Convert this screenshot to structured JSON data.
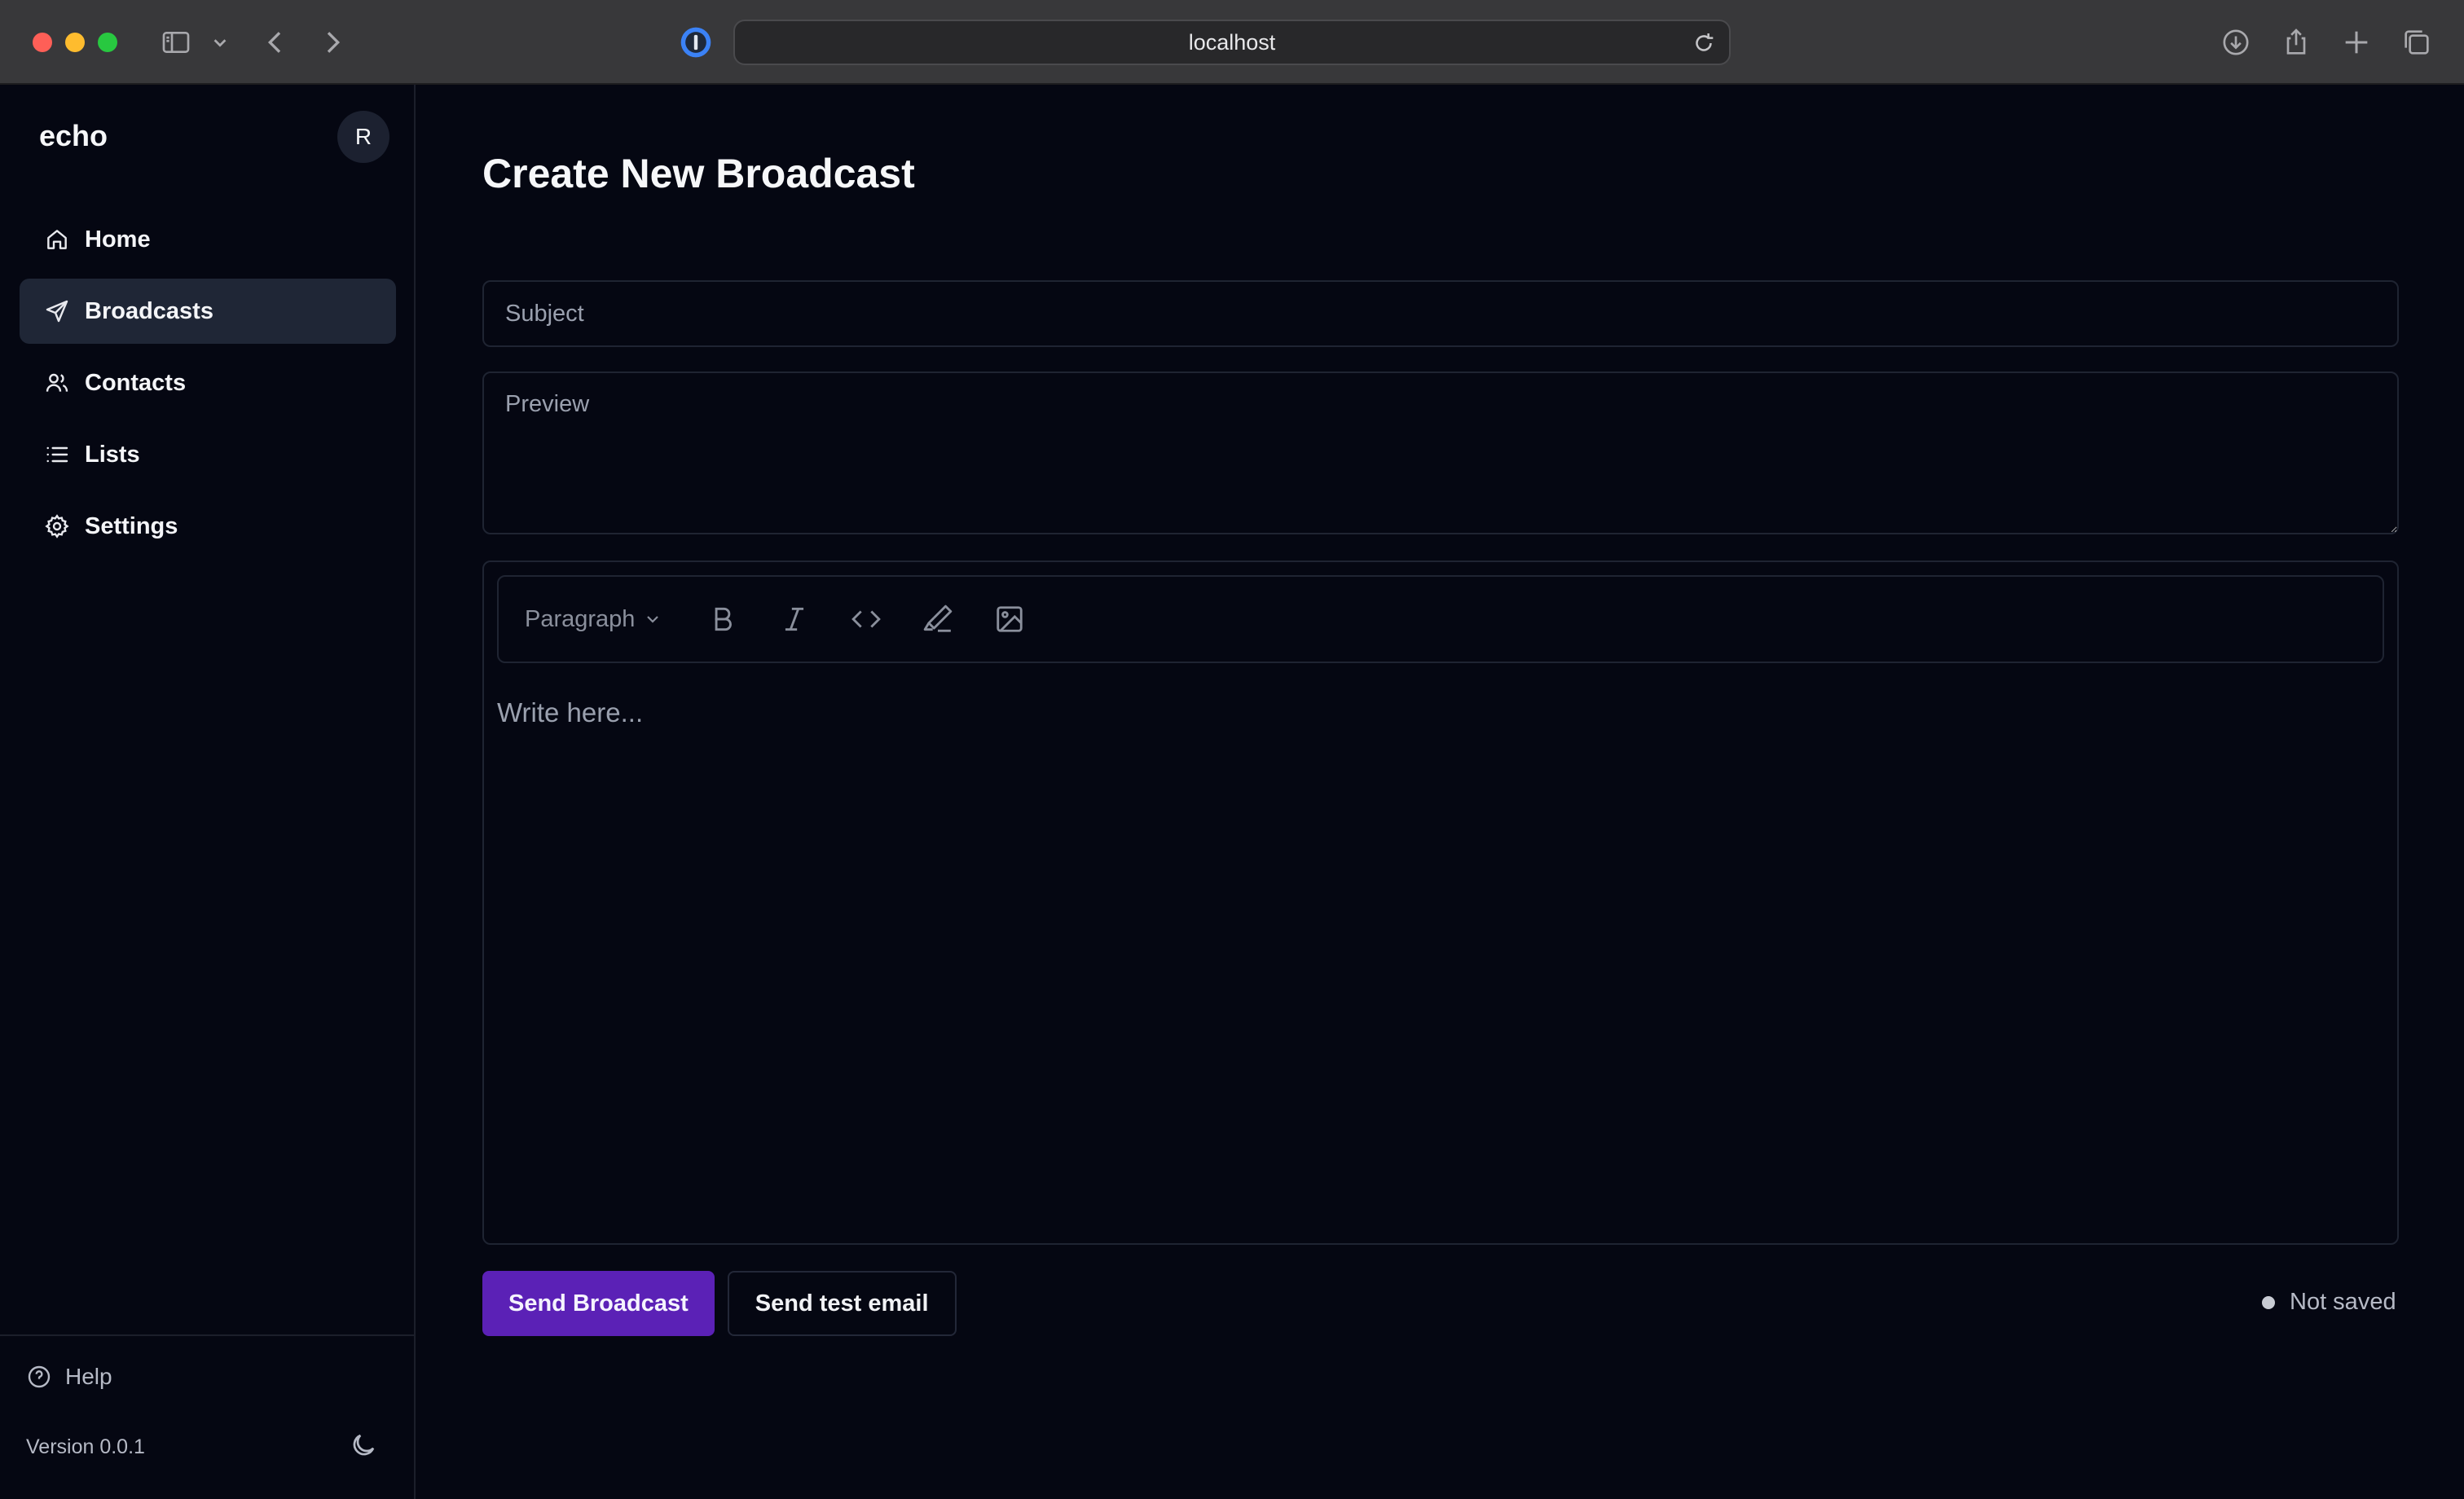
{
  "browser": {
    "url": "localhost"
  },
  "sidebar": {
    "brand": "echo",
    "avatar_initial": "R",
    "items": [
      {
        "label": "Home",
        "icon": "home-icon",
        "active": false
      },
      {
        "label": "Broadcasts",
        "icon": "send-icon",
        "active": true
      },
      {
        "label": "Contacts",
        "icon": "users-icon",
        "active": false
      },
      {
        "label": "Lists",
        "icon": "list-icon",
        "active": false
      },
      {
        "label": "Settings",
        "icon": "gear-icon",
        "active": false
      }
    ],
    "help_label": "Help",
    "version": "Version 0.0.1"
  },
  "main": {
    "title": "Create New Broadcast",
    "subject_placeholder": "Subject",
    "preview_placeholder": "Preview",
    "editor": {
      "block_type": "Paragraph",
      "placeholder": "Write here...",
      "tools": [
        "bold-icon",
        "italic-icon",
        "code-icon",
        "highlighter-icon",
        "image-icon"
      ]
    },
    "send_button": "Send Broadcast",
    "test_button": "Send test email",
    "save_status": "Not saved"
  },
  "colors": {
    "background": "#050712",
    "sidebar_active": "#1f2636",
    "primary": "#5b21b6",
    "border": "#1f2432"
  }
}
